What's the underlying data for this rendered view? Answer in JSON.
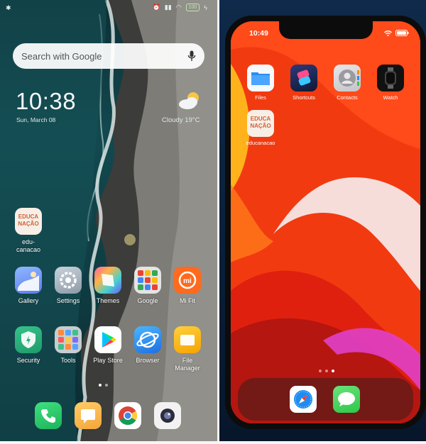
{
  "android": {
    "status": {
      "battery": "100"
    },
    "search": {
      "placeholder": "Search with Google"
    },
    "clock": {
      "time": "10:38",
      "date": "Sun, March 08"
    },
    "weather": {
      "label": "Cloudy  19°C"
    },
    "apps": [
      {
        "label": "edu-\ncanacao",
        "icon": "educacao-logo-icon"
      },
      {
        "label": "Gallery",
        "icon": "gallery-icon"
      },
      {
        "label": "Settings",
        "icon": "settings-gear-icon"
      },
      {
        "label": "Themes",
        "icon": "themes-icon"
      },
      {
        "label": "Google",
        "icon": "google-folder-icon"
      },
      {
        "label": "Mi Fit",
        "icon": "mi-fit-icon"
      },
      {
        "label": "Security",
        "icon": "security-shield-icon"
      },
      {
        "label": "Tools",
        "icon": "tools-folder-icon"
      },
      {
        "label": "Play Store",
        "icon": "play-store-icon"
      },
      {
        "label": "Browser",
        "icon": "browser-icon"
      },
      {
        "label": "File\nManager",
        "icon": "file-manager-icon"
      }
    ],
    "dock": [
      "phone-icon",
      "messages-icon",
      "chrome-icon",
      "camera-icon"
    ]
  },
  "ios": {
    "status": {
      "time": "10:49"
    },
    "apps": [
      {
        "label": "Files",
        "icon": "files-folder-icon"
      },
      {
        "label": "Shortcuts",
        "icon": "shortcuts-icon"
      },
      {
        "label": "Contacts",
        "icon": "contacts-icon"
      },
      {
        "label": "Watch",
        "icon": "watch-icon"
      },
      {
        "label": "educanacao",
        "icon": "educacao-logo-icon"
      }
    ],
    "dock": [
      "safari-icon",
      "messages-icon"
    ]
  },
  "logo": {
    "line1": "EDUCA",
    "line2": "NAÇÃO"
  },
  "colors": {
    "ios_wallpaper": "#f23a10",
    "android_sea": "#12494f"
  }
}
